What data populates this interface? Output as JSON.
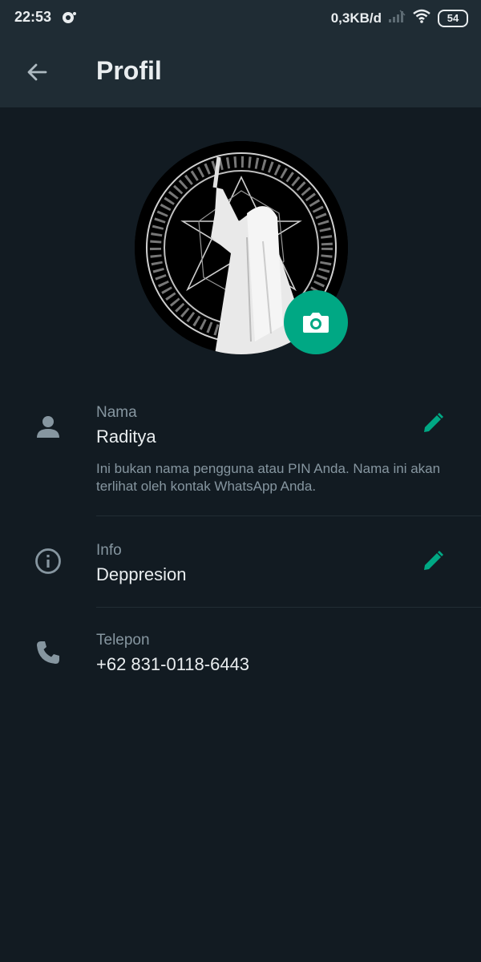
{
  "status": {
    "time": "22:53",
    "speed": "0,3KB/d",
    "battery": "54"
  },
  "appbar": {
    "title": "Profil"
  },
  "profile": {
    "name_label": "Nama",
    "name_value": "Raditya",
    "name_hint": "Ini bukan nama pengguna atau PIN Anda. Nama ini akan terlihat oleh kontak WhatsApp Anda.",
    "info_label": "Info",
    "info_value": "Deppresion",
    "phone_label": "Telepon",
    "phone_value": "+62 831-0118-6443"
  },
  "colors": {
    "background": "#121b22",
    "bar": "#1f2c34",
    "accent": "#00a884",
    "secondary_text": "#8696a0"
  },
  "icons": {
    "back": "arrow-left-icon",
    "camera": "camera-icon",
    "person": "person-icon",
    "info": "info-icon",
    "phone": "phone-icon",
    "edit": "pencil-icon"
  }
}
